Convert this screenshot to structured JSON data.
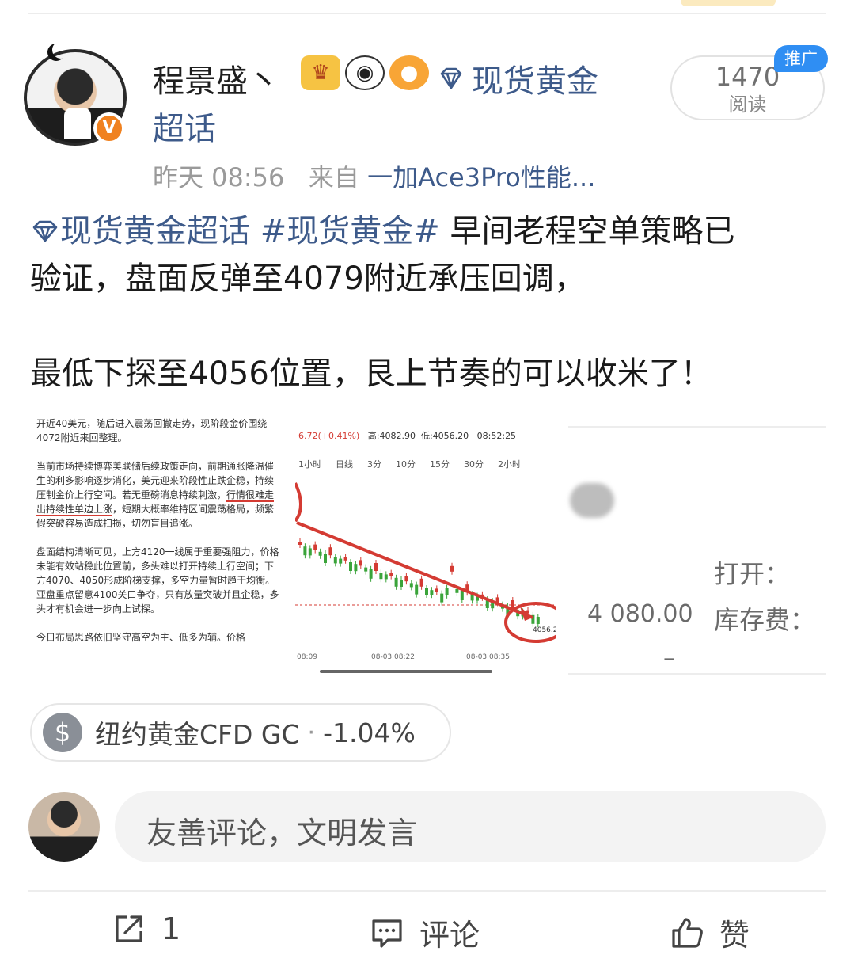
{
  "user": {
    "name": "程景盛丶",
    "badges": [
      "crown-badge",
      "panda-badge",
      "fish-badge"
    ],
    "verified": "V",
    "topic_part1": "现货黄金",
    "topic_part2": "超话"
  },
  "read": {
    "count": "1470",
    "label": "阅读",
    "promo": "推广"
  },
  "meta": {
    "time": "昨天 08:56",
    "from": "来自",
    "device": "一加Ace3Pro性能..."
  },
  "post": {
    "tag1": "现货黄金超话",
    "tag2": "#现货黄金#",
    "line1_rest": " 早间老程空单策略已",
    "line2": "验证，盘面反弹至4079附近承压回调，",
    "line3": "最低下探至4056位置，艮上节奏的可以收米了！"
  },
  "images": {
    "note": {
      "p1": "开近40美元，随后进入震荡回撤走势，现阶段金价围绕4072附近来回整理。",
      "p2a": "当前市场持续博弈美联储后续政策走向，前期通胀降温催生的利多影响逐步消化，美元迎来阶段性止跌企稳，持续压制金价上行空间。若无重磅消息持续刺激，",
      "p2b": "行情很难走出持续性单边上涨",
      "p2c": "，短期大概率维持区间震荡格局，频繁假突破容易造成扫损，切勿盲目追涨。",
      "p3": "盘面结构清晰可见，上方4120一线属于重要强阻力，价格未能有效站稳此位置前，多头难以打开持续上行空间；下方4070、4050形成阶梯支撑，多空力量暂时趋于均衡。亚盘重点留意4100关口争夺，只有放量突破并且企稳，多头才有机会进一步向上试探。",
      "p4": "今日布局思路依旧坚守高空为主、低多为辅。价格"
    },
    "chart": {
      "change": "6.72(+0.41%)",
      "high": "高:4082.90",
      "low": "低:4056.20",
      "time": "08:52:25",
      "tabs": [
        "1小时",
        "日线",
        "3分",
        "10分",
        "15分",
        "30分",
        "2小时"
      ],
      "low_label": "4056.2",
      "t1": "08:09",
      "t2": "08-03 08:22",
      "t3": "08-03 08:35",
      "up_color": "#3aa43a",
      "down_color": "#d43b33"
    },
    "quote": {
      "open_label": "打开：",
      "price": "4 080.00",
      "fee_label": "库存费：",
      "dash": "–"
    }
  },
  "stock": {
    "icon": "$",
    "name": "纽约黄金CFD GC",
    "sep": "·",
    "change": "-1.04%"
  },
  "comment": {
    "placeholder": "友善评论，文明发言"
  },
  "actions": {
    "share_count": "1",
    "comment_label": "评论",
    "like_label": "赞"
  },
  "colors": {
    "link": "#3d5a8a",
    "verified": "#f0811f",
    "promo": "#2f8ef3"
  }
}
